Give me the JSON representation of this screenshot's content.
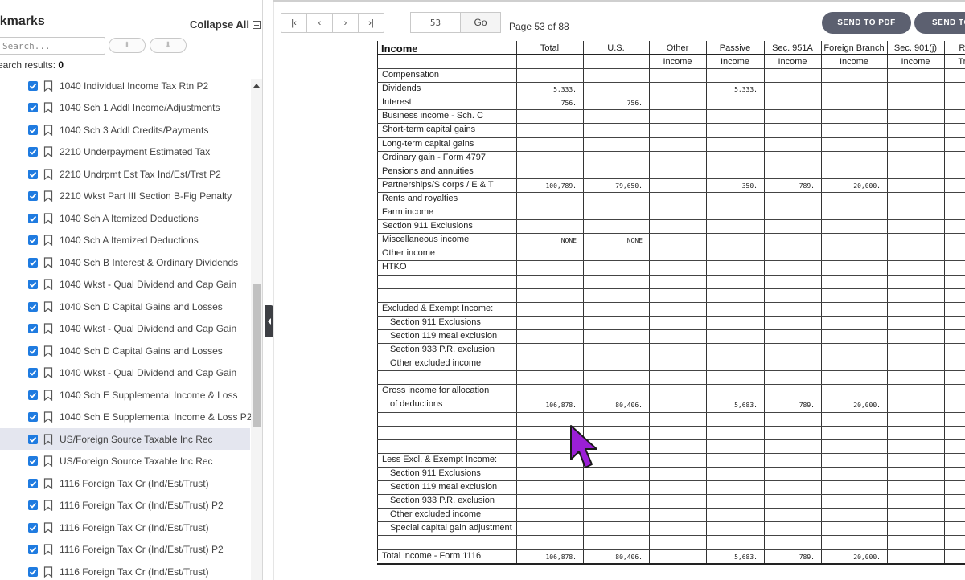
{
  "sidebar": {
    "title": "okmarks",
    "collapse_all": "Collapse All",
    "search_placeholder": "Search...",
    "results_label": "earch results:",
    "results_count": "0",
    "items": [
      {
        "label": "1040 Individual Income Tax Rtn P2",
        "checked": true,
        "selected": false
      },
      {
        "label": "1040 Sch 1 Addl Income/Adjustments",
        "checked": true,
        "selected": false
      },
      {
        "label": "1040 Sch 3 Addl Credits/Payments",
        "checked": true,
        "selected": false
      },
      {
        "label": "2210 Underpayment Estimated Tax",
        "checked": true,
        "selected": false
      },
      {
        "label": "2210 Undrpmt Est Tax Ind/Est/Trst P2",
        "checked": true,
        "selected": false
      },
      {
        "label": "2210 Wkst Part III Section B-Fig Penalty",
        "checked": true,
        "selected": false
      },
      {
        "label": "1040 Sch A Itemized Deductions",
        "checked": true,
        "selected": false
      },
      {
        "label": "1040 Sch A Itemized Deductions",
        "checked": true,
        "selected": false
      },
      {
        "label": "1040 Sch B Interest & Ordinary Dividends",
        "checked": true,
        "selected": false
      },
      {
        "label": "1040 Wkst - Qual Dividend and Cap Gain",
        "checked": true,
        "selected": false
      },
      {
        "label": "1040 Sch D Capital Gains and Losses",
        "checked": true,
        "selected": false
      },
      {
        "label": "1040 Wkst - Qual Dividend and Cap Gain",
        "checked": true,
        "selected": false
      },
      {
        "label": "1040 Sch D Capital Gains and Losses",
        "checked": true,
        "selected": false
      },
      {
        "label": "1040 Wkst - Qual Dividend and Cap Gain",
        "checked": true,
        "selected": false
      },
      {
        "label": "1040 Sch E Supplemental Income & Loss",
        "checked": true,
        "selected": false
      },
      {
        "label": "1040 Sch E Supplemental Income & Loss P2",
        "checked": true,
        "selected": false
      },
      {
        "label": "US/Foreign Source Taxable Inc Rec",
        "checked": true,
        "selected": true
      },
      {
        "label": "US/Foreign Source Taxable Inc Rec",
        "checked": true,
        "selected": false
      },
      {
        "label": "1116 Foreign Tax Cr (Ind/Est/Trust)",
        "checked": true,
        "selected": false
      },
      {
        "label": "1116 Foreign Tax Cr (Ind/Est/Trust) P2",
        "checked": true,
        "selected": false
      },
      {
        "label": "1116 Foreign Tax Cr (Ind/Est/Trust)",
        "checked": true,
        "selected": false
      },
      {
        "label": "1116 Foreign Tax Cr (Ind/Est/Trust) P2",
        "checked": true,
        "selected": false
      },
      {
        "label": "1116 Foreign Tax Cr (Ind/Est/Trust)",
        "checked": true,
        "selected": false
      }
    ]
  },
  "toolbar": {
    "first_label": "|‹",
    "prev_label": "‹",
    "next_label": "›",
    "last_label": "›|",
    "page_value": "53",
    "go_label": "Go",
    "page_text": "Page 53 of 88",
    "send_pdf_label": "SEND TO PDF",
    "send_to_label": "SEND TO"
  },
  "document": {
    "title": "Income",
    "columns": [
      {
        "line1": "Total",
        "line2": ""
      },
      {
        "line1": "U.S.",
        "line2": ""
      },
      {
        "line1": "Other",
        "line2": "Income"
      },
      {
        "line1": "Passive",
        "line2": "Income"
      },
      {
        "line1": "Sec. 951A",
        "line2": "Income"
      },
      {
        "line1": "Foreign Branch",
        "line2": "Income"
      },
      {
        "line1": "Sec. 901(j)",
        "line2": "Income"
      },
      {
        "line1": "Re-s",
        "line2": "Treat"
      }
    ],
    "rows": [
      {
        "label": "Compensation",
        "values": [
          "",
          "",
          "",
          "",
          "",
          "",
          "",
          ""
        ]
      },
      {
        "label": "Dividends",
        "values": [
          "5,333.",
          "",
          "",
          "5,333.",
          "",
          "",
          "",
          ""
        ]
      },
      {
        "label": "Interest",
        "values": [
          "756.",
          "756.",
          "",
          "",
          "",
          "",
          "",
          ""
        ]
      },
      {
        "label": "Business income - Sch. C",
        "values": [
          "",
          "",
          "",
          "",
          "",
          "",
          "",
          ""
        ]
      },
      {
        "label": "Short-term capital gains",
        "values": [
          "",
          "",
          "",
          "",
          "",
          "",
          "",
          ""
        ]
      },
      {
        "label": "Long-term capital gains",
        "values": [
          "",
          "",
          "",
          "",
          "",
          "",
          "",
          ""
        ]
      },
      {
        "label": "Ordinary gain - Form 4797",
        "values": [
          "",
          "",
          "",
          "",
          "",
          "",
          "",
          ""
        ]
      },
      {
        "label": "Pensions and annuities",
        "values": [
          "",
          "",
          "",
          "",
          "",
          "",
          "",
          ""
        ]
      },
      {
        "label": "Partnerships/S corps / E & T",
        "values": [
          "100,789.",
          "79,650.",
          "",
          "350.",
          "789.",
          "20,000.",
          "",
          ""
        ]
      },
      {
        "label": "Rents and royalties",
        "values": [
          "",
          "",
          "",
          "",
          "",
          "",
          "",
          ""
        ]
      },
      {
        "label": "Farm income",
        "values": [
          "",
          "",
          "",
          "",
          "",
          "",
          "",
          ""
        ]
      },
      {
        "label": "Section 911 Exclusions",
        "values": [
          "",
          "",
          "",
          "",
          "",
          "",
          "",
          ""
        ]
      },
      {
        "label": "Miscellaneous income",
        "values": [
          "NONE",
          "NONE",
          "",
          "",
          "",
          "",
          "",
          ""
        ]
      },
      {
        "label": "Other income",
        "values": [
          "",
          "",
          "",
          "",
          "",
          "",
          "",
          ""
        ]
      },
      {
        "label": "HTKO",
        "values": [
          "",
          "",
          "",
          "",
          "",
          "",
          "",
          ""
        ]
      },
      {
        "label": "",
        "values": [
          "",
          "",
          "",
          "",
          "",
          "",
          "",
          ""
        ]
      },
      {
        "label": "",
        "values": [
          "",
          "",
          "",
          "",
          "",
          "",
          "",
          ""
        ]
      },
      {
        "label": "Excluded & Exempt Income:",
        "values": [
          "",
          "",
          "",
          "",
          "",
          "",
          "",
          ""
        ]
      },
      {
        "label": "Section 911 Exclusions",
        "indent": true,
        "values": [
          "",
          "",
          "",
          "",
          "",
          "",
          "",
          ""
        ]
      },
      {
        "label": "Section 119 meal exclusion",
        "indent": true,
        "values": [
          "",
          "",
          "",
          "",
          "",
          "",
          "",
          ""
        ]
      },
      {
        "label": "Section 933 P.R. exclusion",
        "indent": true,
        "values": [
          "",
          "",
          "",
          "",
          "",
          "",
          "",
          ""
        ]
      },
      {
        "label": "Other excluded income",
        "indent": true,
        "values": [
          "",
          "",
          "",
          "",
          "",
          "",
          "",
          ""
        ]
      },
      {
        "label": "",
        "values": [
          "",
          "",
          "",
          "",
          "",
          "",
          "",
          ""
        ]
      },
      {
        "label": "Gross income for allocation",
        "values": [
          "",
          "",
          "",
          "",
          "",
          "",
          "",
          ""
        ]
      },
      {
        "label": "of deductions",
        "indent": true,
        "values": [
          "106,878.",
          "80,406.",
          "",
          "5,683.",
          "789.",
          "20,000.",
          "",
          ""
        ]
      },
      {
        "label": "",
        "values": [
          "",
          "",
          "",
          "",
          "",
          "",
          "",
          ""
        ]
      },
      {
        "label": "",
        "values": [
          "",
          "",
          "",
          "",
          "",
          "",
          "",
          ""
        ]
      },
      {
        "label": "",
        "values": [
          "",
          "",
          "",
          "",
          "",
          "",
          "",
          ""
        ]
      },
      {
        "label": "Less Excl. & Exempt Income:",
        "values": [
          "",
          "",
          "",
          "",
          "",
          "",
          "",
          ""
        ]
      },
      {
        "label": "Section 911 Exclusions",
        "indent": true,
        "values": [
          "",
          "",
          "",
          "",
          "",
          "",
          "",
          ""
        ]
      },
      {
        "label": "Section 119 meal exclusion",
        "indent": true,
        "values": [
          "",
          "",
          "",
          "",
          "",
          "",
          "",
          ""
        ]
      },
      {
        "label": "Section 933 P.R. exclusion",
        "indent": true,
        "values": [
          "",
          "",
          "",
          "",
          "",
          "",
          "",
          ""
        ]
      },
      {
        "label": "Other excluded income",
        "indent": true,
        "values": [
          "",
          "",
          "",
          "",
          "",
          "",
          "",
          ""
        ]
      },
      {
        "label": "Special capital gain adjustment",
        "indent": true,
        "values": [
          "",
          "",
          "",
          "",
          "",
          "",
          "",
          ""
        ]
      },
      {
        "label": "",
        "values": [
          "",
          "",
          "",
          "",
          "",
          "",
          "",
          ""
        ]
      },
      {
        "label": "Total income - Form 1116",
        "values": [
          "106,878.",
          "80,406.",
          "",
          "5,683.",
          "789.",
          "20,000.",
          "",
          ""
        ]
      }
    ]
  }
}
